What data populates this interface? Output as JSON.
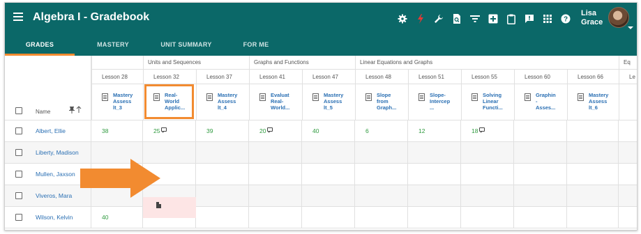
{
  "app": {
    "title": "Algebra I - Gradebook"
  },
  "user": {
    "first": "Lisa",
    "last": "Grace"
  },
  "toolbar_icons": [
    "gear-icon",
    "flash-icon",
    "wrench-icon",
    "search-document-icon",
    "filter-icon",
    "add-box-icon",
    "clipboard-icon",
    "feedback-icon",
    "apps-grid-icon",
    "help-icon"
  ],
  "tabs": [
    {
      "label": "GRADES",
      "active": true
    },
    {
      "label": "MASTERY",
      "active": false
    },
    {
      "label": "UNIT SUMMARY",
      "active": false
    },
    {
      "label": "FOR ME",
      "active": false
    }
  ],
  "groups": [
    {
      "label": "Units and Sequences"
    },
    {
      "label": "Graphs and Functions"
    },
    {
      "label": "Linear Equations and Graphs"
    },
    {
      "label": "Eq"
    }
  ],
  "columns": [
    {
      "lesson": "Lesson 28",
      "assessment": "Mastery\nAssess\nlt_3"
    },
    {
      "lesson": "Lesson 32",
      "assessment": "Real-\nWorld\nApplic..."
    },
    {
      "lesson": "Lesson 37",
      "assessment": "Mastery\nAssess\nlt_4"
    },
    {
      "lesson": "Lesson 41",
      "assessment": "Evaluat\nReal-\nWorld..."
    },
    {
      "lesson": "Lesson 47",
      "assessment": "Mastery\nAssess\nlt_5"
    },
    {
      "lesson": "Lesson 48",
      "assessment": "Slope\nfrom\nGraph..."
    },
    {
      "lesson": "Lesson 51",
      "assessment": "Slope-\nIntercep\n..."
    },
    {
      "lesson": "Lesson 55",
      "assessment": "Solving\nLinear\nFuncti..."
    },
    {
      "lesson": "Lesson 60",
      "assessment": "Graphin\n-\nAsses..."
    },
    {
      "lesson": "Lesson 66",
      "assessment": "Mastery\nAssess\nlt_6"
    },
    {
      "lesson": "Le",
      "assessment": ""
    }
  ],
  "name_header": "Name",
  "students": [
    {
      "name": "Albert, Ellie",
      "scores": [
        "38",
        "25",
        "39",
        "20",
        "40",
        "6",
        "12",
        "18",
        "",
        "",
        ""
      ],
      "comments": [
        false,
        true,
        false,
        true,
        false,
        false,
        false,
        true,
        false,
        false,
        false
      ]
    },
    {
      "name": "Liberty, Madison",
      "scores": [
        "",
        "",
        "",
        "",
        "",
        "",
        "",
        "",
        "",
        "",
        ""
      ],
      "comments": [
        false,
        false,
        false,
        false,
        false,
        false,
        false,
        false,
        false,
        false,
        false
      ]
    },
    {
      "name": "Mullen, Jaxson",
      "scores": [
        "",
        "",
        "",
        "",
        "",
        "",
        "",
        "",
        "",
        "",
        ""
      ],
      "comments": [
        false,
        false,
        false,
        false,
        false,
        false,
        false,
        false,
        false,
        false,
        false
      ]
    },
    {
      "name": "Viveros, Mara",
      "scores": [
        "",
        "",
        "",
        "",
        "",
        "",
        "",
        "",
        "",
        "",
        ""
      ],
      "comments": [
        false,
        false,
        false,
        false,
        false,
        false,
        false,
        false,
        false,
        false,
        false
      ]
    },
    {
      "name": "Wilson, Kelvin",
      "scores": [
        "40",
        "",
        "",
        "",
        "",
        "",
        "",
        "",
        "",
        "",
        ""
      ],
      "comments": [
        false,
        false,
        false,
        false,
        false,
        false,
        false,
        false,
        false,
        false,
        false
      ]
    }
  ],
  "colors": {
    "topbar": "#0b6868",
    "accent": "#f28b30",
    "link": "#2a6fb3",
    "score": "#2e9a3e",
    "missing_cell": "#fde5e5"
  }
}
